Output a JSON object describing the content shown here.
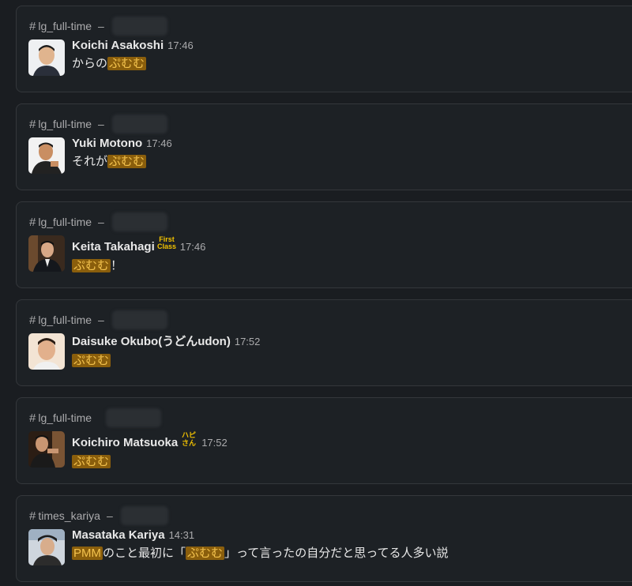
{
  "messages": [
    {
      "channel": "lg_full-time",
      "name": "Koichi Asakoshi",
      "time": "17:46",
      "pre": "からの",
      "hl": "ぷむむ",
      "post": "",
      "hl2": "",
      "post2": ""
    },
    {
      "channel": "lg_full-time",
      "name": "Yuki Motono",
      "time": "17:46",
      "pre": "それが",
      "hl": "ぷむむ",
      "post": "",
      "hl2": "",
      "post2": ""
    },
    {
      "channel": "lg_full-time",
      "name": "Keita Takahagi",
      "time": "17:46",
      "badge_text": "First Class",
      "pre": "",
      "hl": "ぷむむ",
      "post": "！",
      "hl2": "",
      "post2": ""
    },
    {
      "channel": "lg_full-time",
      "name": "Daisuke Okubo(うどんudon)",
      "time": "17:52",
      "pre": "",
      "hl": "ぷむむ",
      "post": "",
      "hl2": "",
      "post2": ""
    },
    {
      "channel": "lg_full-time",
      "name": "Koichiro Matsuoka",
      "time": "17:52",
      "badge_text": "ハピさん",
      "pre": "",
      "hl": "ぷむむ",
      "post": "",
      "hl2": "",
      "post2": ""
    },
    {
      "channel": "times_kariya",
      "name": "Masataka Kariya",
      "time": "14:31",
      "pre": "",
      "hl": "PMM",
      "post": "のこと最初に「",
      "hl2": "ぷむむ",
      "post2": "」って言ったの自分だと思ってる人多い説"
    }
  ],
  "colors": {
    "highlight_bg": "#8a5e0c",
    "highlight_fg": "#f4c34e"
  },
  "icons": [
    "hash-icon",
    "first-class-badge",
    "happy-badge"
  ]
}
